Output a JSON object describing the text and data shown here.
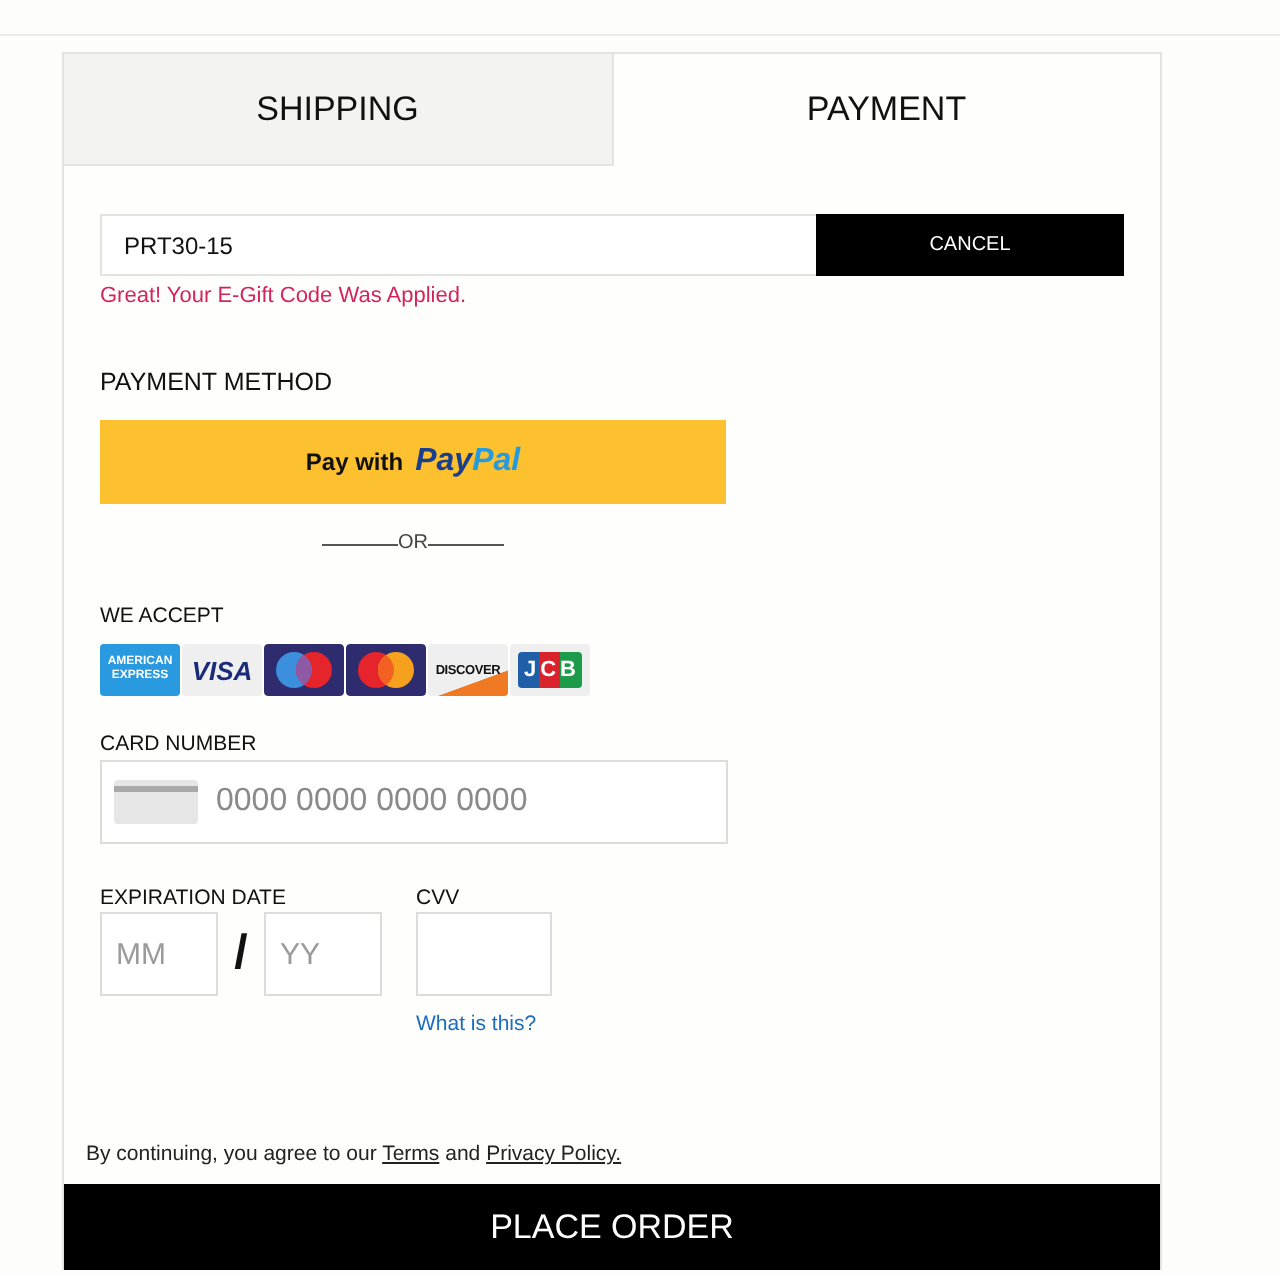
{
  "tabs": [
    {
      "label": "SHIPPING",
      "selected": false
    },
    {
      "label": "PAYMENT",
      "selected": true
    }
  ],
  "gift_code": {
    "value": "PRT30-15",
    "cancel_button": "CANCEL",
    "message": "Great! Your E-Gift Code Was Applied."
  },
  "payment_method": {
    "heading": "PAYMENT METHOD",
    "paypal_button": {
      "label": "Pay with",
      "logo_parts": [
        "Pay",
        "Pal"
      ]
    },
    "divider": "OR"
  },
  "accepted_cards": {
    "label": "WE ACCEPT",
    "cards": [
      {
        "kind": "amex",
        "text": "AMERICAN EXPRESS"
      },
      {
        "kind": "visa",
        "text": "VISA"
      },
      {
        "kind": "maestro"
      },
      {
        "kind": "mastercard"
      },
      {
        "kind": "discover",
        "text": "DISCOVER"
      },
      {
        "kind": "jcb",
        "text": "JCB"
      }
    ]
  },
  "card_number": {
    "label": "CARD NUMBER",
    "placeholder": "0000 0000 0000 0000"
  },
  "expiration": {
    "label": "EXPIRATION DATE",
    "month": {
      "placeholder": "MM"
    },
    "separator": "/",
    "year": {
      "placeholder": "YY"
    }
  },
  "cvv": {
    "label": "CVV",
    "help_link": "What is this?"
  },
  "consent": [
    {
      "kind": "text",
      "text": "By continuing, you agree to our"
    },
    {
      "kind": "link",
      "text": "Terms"
    },
    {
      "kind": "text",
      "text": "and"
    },
    {
      "kind": "link",
      "text": "Privacy Policy."
    }
  ],
  "place_order_button": "PLACE ORDER"
}
